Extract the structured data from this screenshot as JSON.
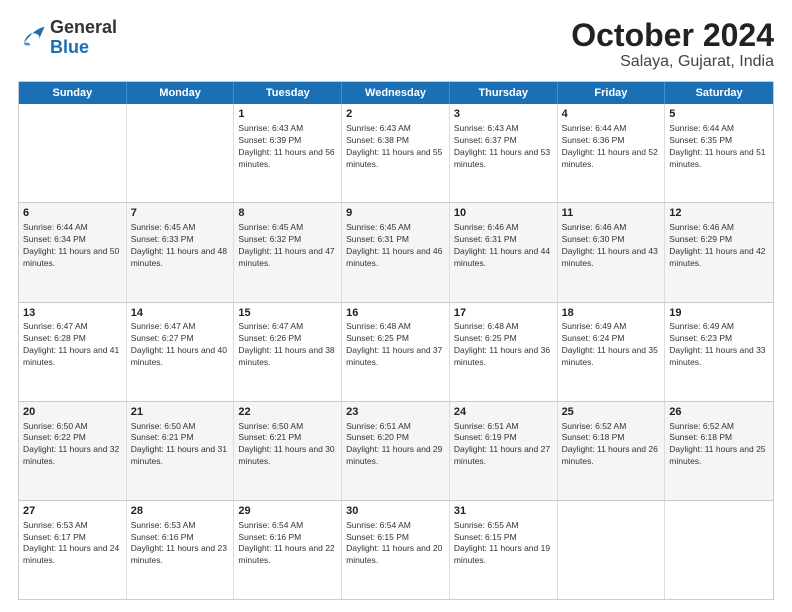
{
  "logo": {
    "line1": "General",
    "line2": "Blue"
  },
  "title": "October 2024",
  "subtitle": "Salaya, Gujarat, India",
  "weekdays": [
    "Sunday",
    "Monday",
    "Tuesday",
    "Wednesday",
    "Thursday",
    "Friday",
    "Saturday"
  ],
  "weeks": [
    [
      {
        "day": "",
        "sunrise": "",
        "sunset": "",
        "daylight": ""
      },
      {
        "day": "",
        "sunrise": "",
        "sunset": "",
        "daylight": ""
      },
      {
        "day": "1",
        "sunrise": "Sunrise: 6:43 AM",
        "sunset": "Sunset: 6:39 PM",
        "daylight": "Daylight: 11 hours and 56 minutes."
      },
      {
        "day": "2",
        "sunrise": "Sunrise: 6:43 AM",
        "sunset": "Sunset: 6:38 PM",
        "daylight": "Daylight: 11 hours and 55 minutes."
      },
      {
        "day": "3",
        "sunrise": "Sunrise: 6:43 AM",
        "sunset": "Sunset: 6:37 PM",
        "daylight": "Daylight: 11 hours and 53 minutes."
      },
      {
        "day": "4",
        "sunrise": "Sunrise: 6:44 AM",
        "sunset": "Sunset: 6:36 PM",
        "daylight": "Daylight: 11 hours and 52 minutes."
      },
      {
        "day": "5",
        "sunrise": "Sunrise: 6:44 AM",
        "sunset": "Sunset: 6:35 PM",
        "daylight": "Daylight: 11 hours and 51 minutes."
      }
    ],
    [
      {
        "day": "6",
        "sunrise": "Sunrise: 6:44 AM",
        "sunset": "Sunset: 6:34 PM",
        "daylight": "Daylight: 11 hours and 50 minutes."
      },
      {
        "day": "7",
        "sunrise": "Sunrise: 6:45 AM",
        "sunset": "Sunset: 6:33 PM",
        "daylight": "Daylight: 11 hours and 48 minutes."
      },
      {
        "day": "8",
        "sunrise": "Sunrise: 6:45 AM",
        "sunset": "Sunset: 6:32 PM",
        "daylight": "Daylight: 11 hours and 47 minutes."
      },
      {
        "day": "9",
        "sunrise": "Sunrise: 6:45 AM",
        "sunset": "Sunset: 6:31 PM",
        "daylight": "Daylight: 11 hours and 46 minutes."
      },
      {
        "day": "10",
        "sunrise": "Sunrise: 6:46 AM",
        "sunset": "Sunset: 6:31 PM",
        "daylight": "Daylight: 11 hours and 44 minutes."
      },
      {
        "day": "11",
        "sunrise": "Sunrise: 6:46 AM",
        "sunset": "Sunset: 6:30 PM",
        "daylight": "Daylight: 11 hours and 43 minutes."
      },
      {
        "day": "12",
        "sunrise": "Sunrise: 6:46 AM",
        "sunset": "Sunset: 6:29 PM",
        "daylight": "Daylight: 11 hours and 42 minutes."
      }
    ],
    [
      {
        "day": "13",
        "sunrise": "Sunrise: 6:47 AM",
        "sunset": "Sunset: 6:28 PM",
        "daylight": "Daylight: 11 hours and 41 minutes."
      },
      {
        "day": "14",
        "sunrise": "Sunrise: 6:47 AM",
        "sunset": "Sunset: 6:27 PM",
        "daylight": "Daylight: 11 hours and 40 minutes."
      },
      {
        "day": "15",
        "sunrise": "Sunrise: 6:47 AM",
        "sunset": "Sunset: 6:26 PM",
        "daylight": "Daylight: 11 hours and 38 minutes."
      },
      {
        "day": "16",
        "sunrise": "Sunrise: 6:48 AM",
        "sunset": "Sunset: 6:25 PM",
        "daylight": "Daylight: 11 hours and 37 minutes."
      },
      {
        "day": "17",
        "sunrise": "Sunrise: 6:48 AM",
        "sunset": "Sunset: 6:25 PM",
        "daylight": "Daylight: 11 hours and 36 minutes."
      },
      {
        "day": "18",
        "sunrise": "Sunrise: 6:49 AM",
        "sunset": "Sunset: 6:24 PM",
        "daylight": "Daylight: 11 hours and 35 minutes."
      },
      {
        "day": "19",
        "sunrise": "Sunrise: 6:49 AM",
        "sunset": "Sunset: 6:23 PM",
        "daylight": "Daylight: 11 hours and 33 minutes."
      }
    ],
    [
      {
        "day": "20",
        "sunrise": "Sunrise: 6:50 AM",
        "sunset": "Sunset: 6:22 PM",
        "daylight": "Daylight: 11 hours and 32 minutes."
      },
      {
        "day": "21",
        "sunrise": "Sunrise: 6:50 AM",
        "sunset": "Sunset: 6:21 PM",
        "daylight": "Daylight: 11 hours and 31 minutes."
      },
      {
        "day": "22",
        "sunrise": "Sunrise: 6:50 AM",
        "sunset": "Sunset: 6:21 PM",
        "daylight": "Daylight: 11 hours and 30 minutes."
      },
      {
        "day": "23",
        "sunrise": "Sunrise: 6:51 AM",
        "sunset": "Sunset: 6:20 PM",
        "daylight": "Daylight: 11 hours and 29 minutes."
      },
      {
        "day": "24",
        "sunrise": "Sunrise: 6:51 AM",
        "sunset": "Sunset: 6:19 PM",
        "daylight": "Daylight: 11 hours and 27 minutes."
      },
      {
        "day": "25",
        "sunrise": "Sunrise: 6:52 AM",
        "sunset": "Sunset: 6:18 PM",
        "daylight": "Daylight: 11 hours and 26 minutes."
      },
      {
        "day": "26",
        "sunrise": "Sunrise: 6:52 AM",
        "sunset": "Sunset: 6:18 PM",
        "daylight": "Daylight: 11 hours and 25 minutes."
      }
    ],
    [
      {
        "day": "27",
        "sunrise": "Sunrise: 6:53 AM",
        "sunset": "Sunset: 6:17 PM",
        "daylight": "Daylight: 11 hours and 24 minutes."
      },
      {
        "day": "28",
        "sunrise": "Sunrise: 6:53 AM",
        "sunset": "Sunset: 6:16 PM",
        "daylight": "Daylight: 11 hours and 23 minutes."
      },
      {
        "day": "29",
        "sunrise": "Sunrise: 6:54 AM",
        "sunset": "Sunset: 6:16 PM",
        "daylight": "Daylight: 11 hours and 22 minutes."
      },
      {
        "day": "30",
        "sunrise": "Sunrise: 6:54 AM",
        "sunset": "Sunset: 6:15 PM",
        "daylight": "Daylight: 11 hours and 20 minutes."
      },
      {
        "day": "31",
        "sunrise": "Sunrise: 6:55 AM",
        "sunset": "Sunset: 6:15 PM",
        "daylight": "Daylight: 11 hours and 19 minutes."
      },
      {
        "day": "",
        "sunrise": "",
        "sunset": "",
        "daylight": ""
      },
      {
        "day": "",
        "sunrise": "",
        "sunset": "",
        "daylight": ""
      }
    ]
  ]
}
